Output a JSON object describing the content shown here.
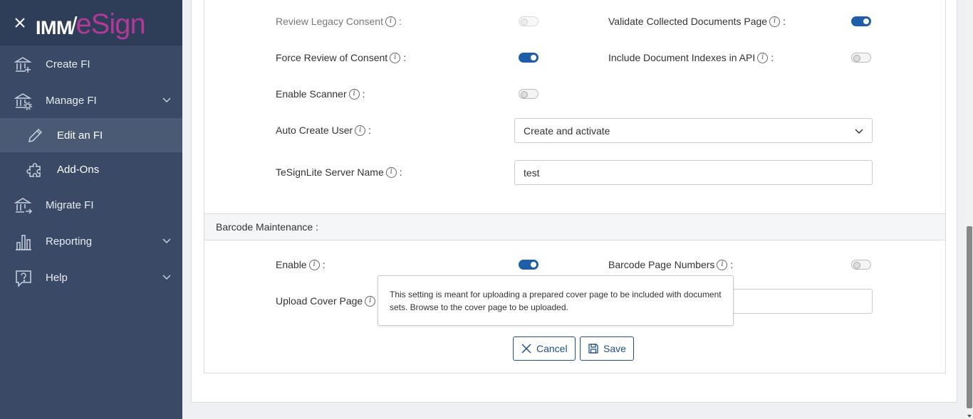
{
  "app": {
    "logo_imm": "IMM",
    "logo_esign": "eSign"
  },
  "sidebar": {
    "items": [
      {
        "label": "Create FI"
      },
      {
        "label": "Manage FI"
      },
      {
        "label": "Edit an FI"
      },
      {
        "label": "Add-Ons"
      },
      {
        "label": "Migrate FI"
      },
      {
        "label": "Reporting"
      },
      {
        "label": "Help"
      }
    ]
  },
  "settings": {
    "review_legacy_consent": {
      "label": "Review Legacy Consent",
      "state": "off",
      "disabled": true
    },
    "validate_collected_documents_page": {
      "label": "Validate Collected Documents Page",
      "state": "on"
    },
    "force_review_of_consent": {
      "label": "Force Review of Consent",
      "state": "on"
    },
    "include_document_indexes_in_api": {
      "label": "Include Document Indexes in API",
      "state": "off"
    },
    "enable_scanner": {
      "label": "Enable Scanner",
      "state": "off"
    },
    "auto_create_user": {
      "label": "Auto Create User",
      "value": "Create and activate"
    },
    "tesignlite_server_name": {
      "label": "TeSignLite Server Name",
      "value": "test"
    }
  },
  "barcode": {
    "section_title": "Barcode Maintenance :",
    "enable": {
      "label": "Enable",
      "state": "on"
    },
    "barcode_page_numbers": {
      "label": "Barcode Page Numbers",
      "state": "off"
    },
    "upload_cover_page": {
      "label": "Upload Cover Page"
    }
  },
  "tooltip": {
    "text": "This setting is meant for uploading a prepared cover page to be included with document sets. Browse to the cover page to be uploaded."
  },
  "actions": {
    "cancel_label": "Cancel",
    "save_label": "Save"
  },
  "icons": {
    "info": "i",
    "close": "close-icon",
    "bank": "bank-icon",
    "pencil": "pencil-icon",
    "puzzle": "puzzle-icon",
    "chart": "bar-chart-icon",
    "help": "question-icon",
    "chevron_down": "chevron-down-icon",
    "save": "floppy-disk-icon"
  },
  "colors": {
    "sidebar": "#3a4a66",
    "accent": "#1e5ea8",
    "brand_magenta": "#b0399a"
  }
}
